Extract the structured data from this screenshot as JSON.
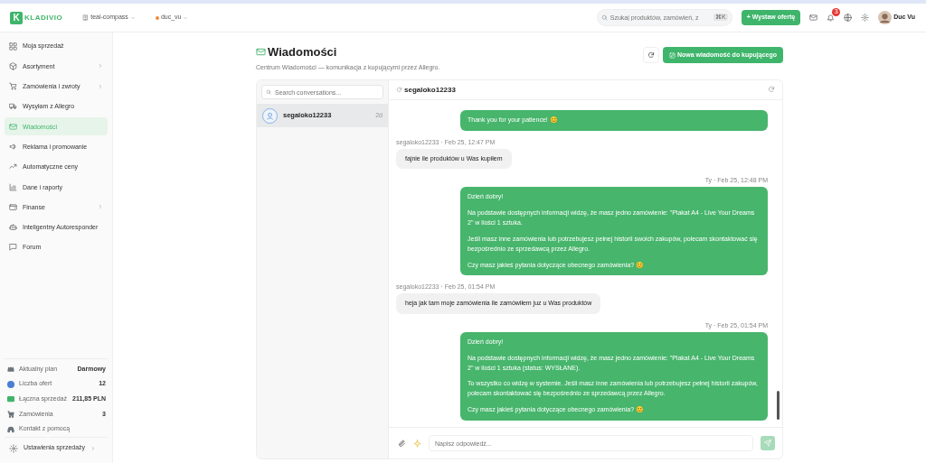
{
  "topbar": {
    "logo_mark": "K",
    "logo": "KLADIVIO",
    "workspace": "teal-compass",
    "account": "duc_vu",
    "search": {
      "placeholder": "Szukaj produktów, zamówień, z",
      "shortcut": "⌘K"
    },
    "create_button": "+ Wystaw ofertę",
    "notifications": "3",
    "user": "Duc Vu"
  },
  "sidebar": {
    "items": [
      {
        "label": "Moja sprzedaż",
        "selected": false,
        "expandable": false
      },
      {
        "label": "Asortyment",
        "selected": false,
        "expandable": true
      },
      {
        "label": "Zamówienia i zwroty",
        "selected": false,
        "expandable": true
      },
      {
        "label": "Wysyłam z Allegro",
        "selected": false,
        "expandable": false
      },
      {
        "label": "Wiadomości",
        "selected": true,
        "expandable": false
      },
      {
        "label": "Reklama i promowanie",
        "selected": false,
        "expandable": false
      },
      {
        "label": "Automatyczne ceny",
        "selected": false,
        "expandable": false
      },
      {
        "label": "Dane i raporty",
        "selected": false,
        "expandable": false
      },
      {
        "label": "Finanse",
        "selected": false,
        "expandable": true
      },
      {
        "label": "Inteligentny Autoresponder",
        "selected": false,
        "expandable": false
      },
      {
        "label": "Forum",
        "selected": false,
        "expandable": false
      }
    ],
    "stats": [
      {
        "label": "Aktualny plan",
        "value": "Darmowy",
        "color": "#6c757d"
      },
      {
        "label": "Liczba ofert",
        "value": "12",
        "color": "#4a7fd4"
      },
      {
        "label": "Łączna sprzedaż",
        "value": "211,85 PLN",
        "color": "#3fb56b"
      },
      {
        "label": "Zamówienia",
        "value": "3",
        "color": "#6c757d"
      },
      {
        "label": "Kontakt z pomocą",
        "color": "#6c757d"
      }
    ],
    "settings": "Ustawienia sprzedaży"
  },
  "page": {
    "title": "Wiadomości",
    "subtitle": "Centrum Wiadomości — komunikacja z kupującymi przez Allegro.",
    "new_button": "Nowa wiadomość do kupującego"
  },
  "conversations": {
    "search": {
      "placeholder": "Search conversations..."
    },
    "items": [
      {
        "name": "segaloko12233",
        "time": "2d",
        "selected": true
      }
    ]
  },
  "chat": {
    "contact": "segaloko12233",
    "composer": {
      "placeholder": "Napisz odpowiedź..."
    },
    "messages": [
      {
        "kind": "outgoing",
        "paragraphs": [
          "Thank you for your patience! 😊"
        ]
      },
      {
        "kind": "incoming",
        "meta": "segaloko12233 · Feb 25, 12:47 PM",
        "paragraphs": [
          "fajnie ile produktów u Was kupiłem"
        ]
      },
      {
        "kind": "outgoing",
        "meta": "Ty · Feb 25, 12:48 PM",
        "paragraphs": [
          "Dzień dobry!",
          "Na podstawie dostępnych informacji widzę, że masz jedno zamówienie: \"Plakat A4 - Live Your Dreams 2\" w ilości 1 sztuka.",
          "Jeśli masz inne zamówienia lub potrzebujesz pełnej historii swoich zakupów, polecam skontaktować się bezpośrednio ze sprzedawcą przez Allegro.",
          "Czy masz jakieś pytania dotyczące obecnego zamówienia? 😊"
        ]
      },
      {
        "kind": "incoming",
        "meta": "segaloko12233 · Feb 25, 01:54 PM",
        "paragraphs": [
          "heja jak tam moje zamówienia ile zamówiłem juz u Was produktów"
        ]
      },
      {
        "kind": "outgoing",
        "meta": "Ty · Feb 25, 01:54 PM",
        "paragraphs": [
          "Dzień dobry!",
          "Na podstawie dostępnych informacji widzę, że masz jedno zamówienie: \"Plakat A4 - Live Your Dreams 2\" w ilości 1 sztuka (status: WYSŁANE).",
          "To wszystko co widzę w systemie. Jeśli masz inne zamówienia lub potrzebujesz pełnej historii zakupów, polecam skontaktować się bezpośrednio ze sprzedawcą przez Allegro.",
          "Czy masz jakieś pytania dotyczące obecnego zamówienia? 😊"
        ]
      }
    ]
  }
}
